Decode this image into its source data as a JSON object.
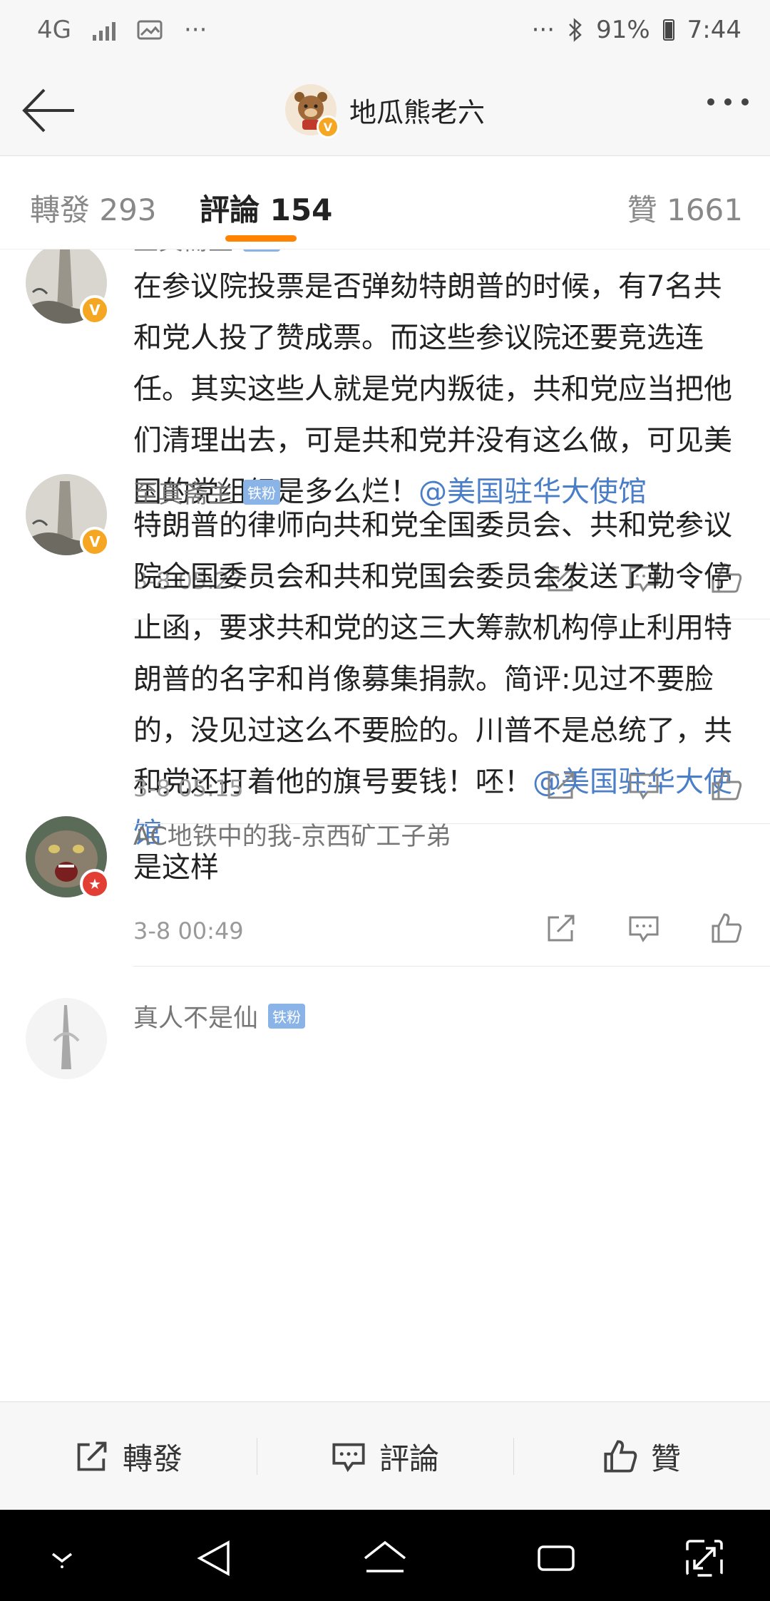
{
  "status_bar": {
    "network": "4G",
    "more": "···",
    "more_right": "···",
    "battery": "91%",
    "time": "7:44"
  },
  "header": {
    "title": "地瓜熊老六"
  },
  "tabs": {
    "repost": "轉發 293",
    "comment": "評論 154",
    "like": "贊 1661"
  },
  "comments": [
    {
      "user": "至真斋主",
      "tag": "铁粉",
      "text": "在参议院投票是否弹劾特朗普的时候，有7名共和党人投了赞成票。而这些参议院还要竞选连任。其实这些人就是党内叛徒，共和党应当把他们清理出去，可是共和党并没有这么做，可见美国的党组织是多么烂！",
      "mention": "@美国驻华大使馆",
      "time": "3-8 05:27"
    },
    {
      "user": "至真斋主",
      "tag": "铁粉",
      "text": "特朗普的律师向共和党全国委员会、共和党参议院全国委员会和共和党国会委员会发送了勒令停止函，要求共和党的这三大筹款机构停止利用特朗普的名字和肖像募集捐款。简评:见过不要脸的，没见过这么不要脸的。川普不是总统了，共和党还打着他的旗号要钱！呸！",
      "mention": "@美国驻华大使馆",
      "time": "3-8 05:15"
    },
    {
      "user": "AC地铁中的我-京西矿工子弟",
      "text": "是这样",
      "time": "3-8 00:49"
    },
    {
      "user": "真人不是仙",
      "tag": "铁粉"
    }
  ],
  "bottom_bar": {
    "repost": "轉發",
    "comment": "評論",
    "like": "贊"
  },
  "colors": {
    "accent": "#ff8200",
    "mention": "#4a7ec7",
    "fan_tag": "#8ab4e8"
  }
}
